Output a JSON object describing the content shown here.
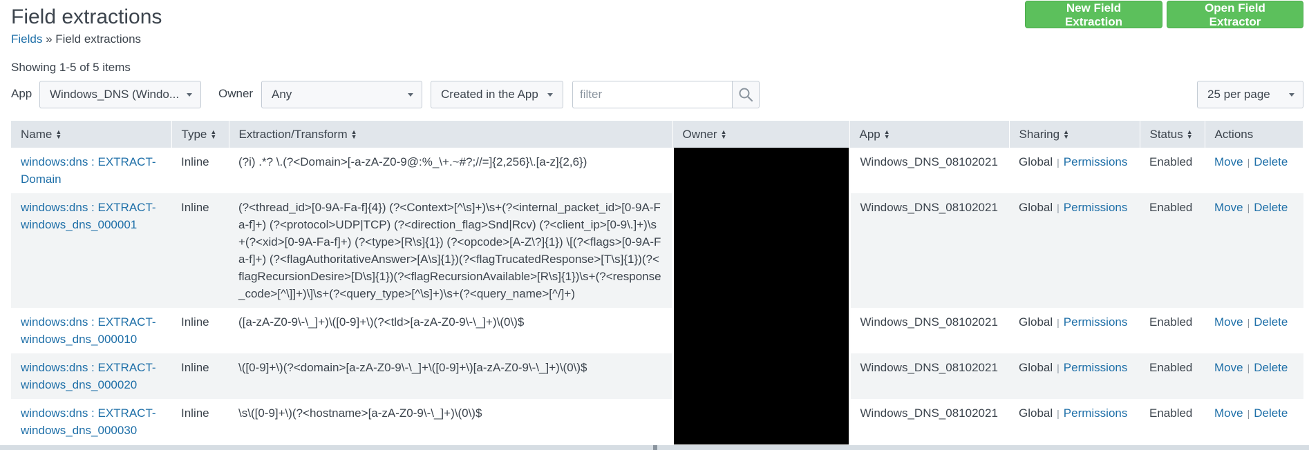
{
  "header": {
    "title": "Field extractions",
    "breadcrumb_link": "Fields",
    "breadcrumb_sep": " » ",
    "breadcrumb_current": "Field extractions"
  },
  "actions": {
    "new_label": "New Field Extraction",
    "open_label": "Open Field Extractor"
  },
  "summary": "Showing 1-5 of 5 items",
  "filters": {
    "app_label": "App",
    "app_value": "Windows_DNS (Windo...",
    "owner_label": "Owner",
    "owner_value": "Any",
    "scope_value": "Created in the App",
    "filter_placeholder": "filter",
    "per_page_value": "25 per page"
  },
  "table": {
    "columns": [
      "Name",
      "Type",
      "Extraction/Transform",
      "Owner",
      "App",
      "Sharing",
      "Status",
      "Actions"
    ],
    "rows": [
      {
        "name": "windows:dns : EXTRACT-Domain",
        "type": "Inline",
        "extraction": "(?i) .*? \\.(?<Domain>[-a-zA-Z0-9@:%_\\+.~#?;//=]{2,256}\\.[a-z]{2,6})",
        "app": "Windows_DNS_08102021",
        "sharing": "Global",
        "permissions": "Permissions",
        "status": "Enabled",
        "move": "Move",
        "delete": "Delete"
      },
      {
        "name": "windows:dns : EXTRACT-windows_dns_000001",
        "type": "Inline",
        "extraction": "(?<thread_id>[0-9A-Fa-f]{4}) (?<Context>[^\\s]+)\\s+(?<internal_packet_id>[0-9A-Fa-f]+) (?<protocol>UDP|TCP) (?<direction_flag>Snd|Rcv) (?<client_ip>[0-9\\.]+)\\s+(?<xid>[0-9A-Fa-f]+) (?<type>[R\\s]{1}) (?<opcode>[A-Z\\?]{1}) \\[(?<flags>[0-9A-Fa-f]+) (?<flagAuthoritativeAnswer>[A\\s]{1})(?<flagTrucatedResponse>[T\\s]{1})(?<flagRecursionDesire>[D\\s]{1})(?<flagRecursionAvailable>[R\\s]{1})\\s+(?<response_code>[^\\]]+)\\]\\s+(?<query_type>[^\\s]+)\\s+(?<query_name>[^/]+)",
        "app": "Windows_DNS_08102021",
        "sharing": "Global",
        "permissions": "Permissions",
        "status": "Enabled",
        "move": "Move",
        "delete": "Delete"
      },
      {
        "name": "windows:dns : EXTRACT-windows_dns_000010",
        "type": "Inline",
        "extraction": "([a-zA-Z0-9\\-\\_]+)\\([0-9]+\\)(?<tld>[a-zA-Z0-9\\-\\_]+)\\(0\\)$",
        "app": "Windows_DNS_08102021",
        "sharing": "Global",
        "permissions": "Permissions",
        "status": "Enabled",
        "move": "Move",
        "delete": "Delete"
      },
      {
        "name": "windows:dns : EXTRACT-windows_dns_000020",
        "type": "Inline",
        "extraction": "\\([0-9]+\\)(?<domain>[a-zA-Z0-9\\-\\_]+\\([0-9]+\\)[a-zA-Z0-9\\-\\_]+)\\(0\\)$",
        "app": "Windows_DNS_08102021",
        "sharing": "Global",
        "permissions": "Permissions",
        "status": "Enabled",
        "move": "Move",
        "delete": "Delete"
      },
      {
        "name": "windows:dns : EXTRACT-windows_dns_000030",
        "type": "Inline",
        "extraction": "\\s\\([0-9]+\\)(?<hostname>[a-zA-Z0-9\\-\\_]+)\\(0\\)$",
        "app": "Windows_DNS_08102021",
        "sharing": "Global",
        "permissions": "Permissions",
        "status": "Enabled",
        "move": "Move",
        "delete": "Delete"
      }
    ]
  },
  "colors": {
    "accent_green": "#5cc05c",
    "link_blue": "#1e6fa8",
    "header_gray": "#e1e6eb",
    "redaction": "#000000"
  },
  "icons": {
    "search": "search-icon",
    "sort": "sort-icon",
    "caret": "caret-down-icon"
  }
}
